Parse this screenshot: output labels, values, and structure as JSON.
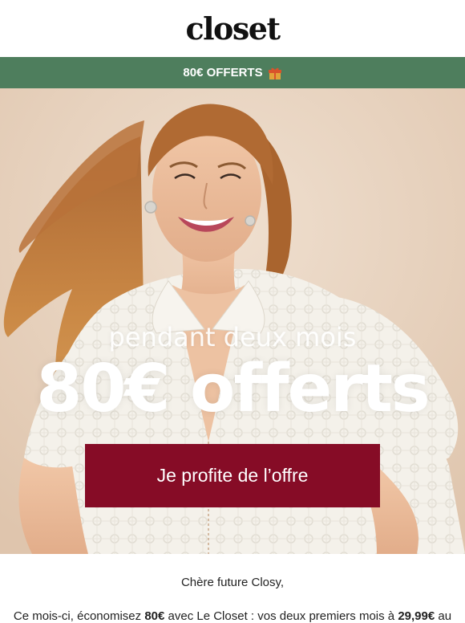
{
  "header": {
    "logo_text": "closet"
  },
  "promo_bar": {
    "text": "80€ OFFERTS",
    "icon": "gift-icon"
  },
  "hero": {
    "subtitle": "pendant deux mois",
    "title": "80€ offerts",
    "cta_label": "Je profite de l’offre"
  },
  "body": {
    "greeting": "Chère future Closy,",
    "paragraph": {
      "part1": "Ce mois-ci, économisez ",
      "amount": "80€",
      "part2": " avec Le Closet : vos deux premiers mois à ",
      "price": "29,99€",
      "part3": " au"
    }
  },
  "colors": {
    "promo_bar_bg": "#4e7e5d",
    "cta_bg": "#860c26",
    "hero_bg": "#e6d1bc"
  }
}
